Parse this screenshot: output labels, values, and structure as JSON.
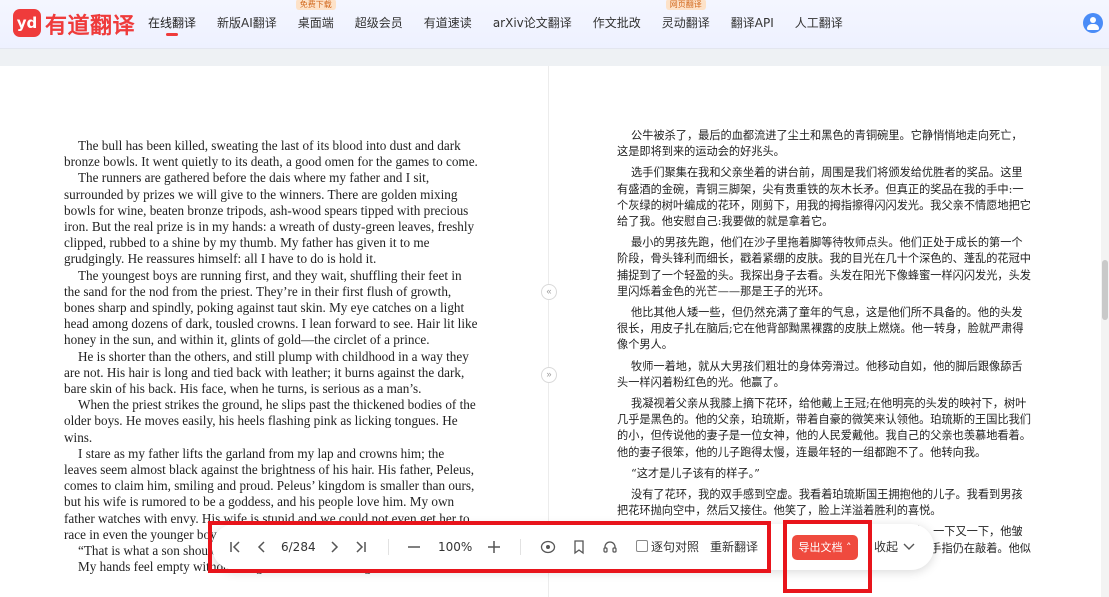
{
  "app": {
    "logo_badge": "yd",
    "logo_text": "有道翻译",
    "brand_color": "#ef3b3b"
  },
  "nav": {
    "items": [
      {
        "label": "在线翻译",
        "active": true
      },
      {
        "label": "新版AI翻译"
      },
      {
        "label": "桌面端",
        "badge": "免费下载"
      },
      {
        "label": "超级会员"
      },
      {
        "label": "有道速读"
      },
      {
        "label": "arXiv论文翻译"
      },
      {
        "label": "作文批改"
      },
      {
        "label": "灵动翻译",
        "badge": "网页翻译"
      },
      {
        "label": "翻译API"
      },
      {
        "label": "人工翻译"
      }
    ],
    "avatar_icon": "user-avatar-icon"
  },
  "source_doc": {
    "paragraphs": [
      "The bull has been killed, sweating the last of its blood into dust and dark bronze bowls. It went quietly to its death, a good omen for the games to come.",
      "The runners are gathered before the dais where my father and I sit, surrounded by prizes we will give to the winners. There are golden mixing bowls for wine, beaten bronze tripods, ash-wood spears tipped with precious iron. But the real prize is in my hands: a wreath of dusty-green leaves, freshly clipped, rubbed to a shine by my thumb. My father has given it to me grudgingly. He reassures himself: all I have to do is hold it.",
      "The youngest boys are running first, and they wait, shuffling their feet in the sand for the nod from the priest. They’re in their first flush of growth, bones sharp and spindly, poking against taut skin. My eye catches on a light head among dozens of dark, tousled crowns. I lean forward to see. Hair lit like honey in the sun, and within it, glints of gold—the circlet of a prince.",
      "He is shorter than the others, and still plump with childhood in a way they are not. His hair is long and tied back with leather; it burns against the dark, bare skin of his back. His face, when he turns, is serious as a man’s.",
      "When the priest strikes the ground, he slips past the thickened bodies of the older boys. He moves easily, his heels flashing pink as licking tongues. He wins.",
      "I stare as my father lifts the garland from my lap and crowns him; the leaves seem almost black against the brightness of his hair. His father, Peleus, comes to claim him, smiling and proud. Peleus’ kingdom is smaller than ours, but his wife is rumored to be a goddess, and his people love him. My own father watches with envy. His wife is stupid and we could not even get her to race in even the younger boys’ race.",
      "“That is what a son should be.”",
      "My hands feel empty without the garland. I watch King Peleus embrace"
    ]
  },
  "translated_doc": {
    "paragraphs": [
      "公牛被杀了，最后的血都流进了尘土和黑色的青铜碗里。它静悄悄地走向死亡，这是即将到来的运动会的好兆头。",
      "选手们聚集在我和父亲坐着的讲台前，周围是我们将颁发给优胜者的奖品。这里有盛酒的金碗，青铜三脚架，尖有贵重铁的灰木长矛。但真正的奖品在我的手中:一个灰绿的树叶编成的花环，刚剪下，用我的拇指擦得闪闪发光。我父亲不情愿地把它给了我。他安慰自己:我要做的就是拿着它。",
      "最小的男孩先跑，他们在沙子里拖着脚等待牧师点头。他们正处于成长的第一个阶段，骨头锋利而细长，戳着紧绷的皮肤。我的目光在几十个深色的、蓬乱的花冠中捕捉到了一个轻盈的头。我探出身子去看。头发在阳光下像蜂蜜一样闪闪发光，头发里闪烁着金色的光芒——那是王子的光环。",
      "他比其他人矮一些，但仍然充满了童年的气息，这是他们所不具备的。他的头发很长，用皮子扎在脑后;它在他背部黝黑裸露的皮肤上燃烧。他一转身，脸就严肃得像个男人。",
      "牧师一着地，就从大男孩们粗壮的身体旁滑过。他移动自如，他的脚后跟像舔舌头一样闪着粉红色的光。他赢了。",
      "我凝视着父亲从我膝上摘下花环，给他戴上王冠;在他明亮的头发的映衬下，树叶几乎是黑色的。他的父亲，珀琉斯，带着自豪的微笑来认领他。珀琉斯的王国比我们的小，但传说他的妻子是一位女神，他的人民爱戴他。我自己的父亲也羡慕地看着。他的妻子很笨，他的儿子跑得太慢，连最年轻的一组都跑不了。他转向我。",
      "“这才是儿子该有的样子。”",
      "没有了花环，我的双手感到空虚。我看着珀琉斯国王拥抱他的儿子。我看到男孩把花环抛向空中，然后又接住。他笑了，脸上洋溢着胜利的喜悦。",
      "在我的视野里，我的父亲在我身边，他的手指在膝盖上敲着，一下又一下，他皱着眉头，我爱着人们所说的那种父亲。在这最后的记忆里，他的手指仍在敲着。他似乎很喜欢这样，那一刻我觉得他是一个很好的人。"
    ]
  },
  "toolbar": {
    "page_indicator": "6/284",
    "zoom": "100%",
    "sentence_align_label": "逐句对照",
    "retranslate_label": "重新翻译",
    "export_label": "导出文档",
    "collapse_label": "收起",
    "export_color": "#ef4a3e",
    "highlight_color": "#e8141b"
  }
}
